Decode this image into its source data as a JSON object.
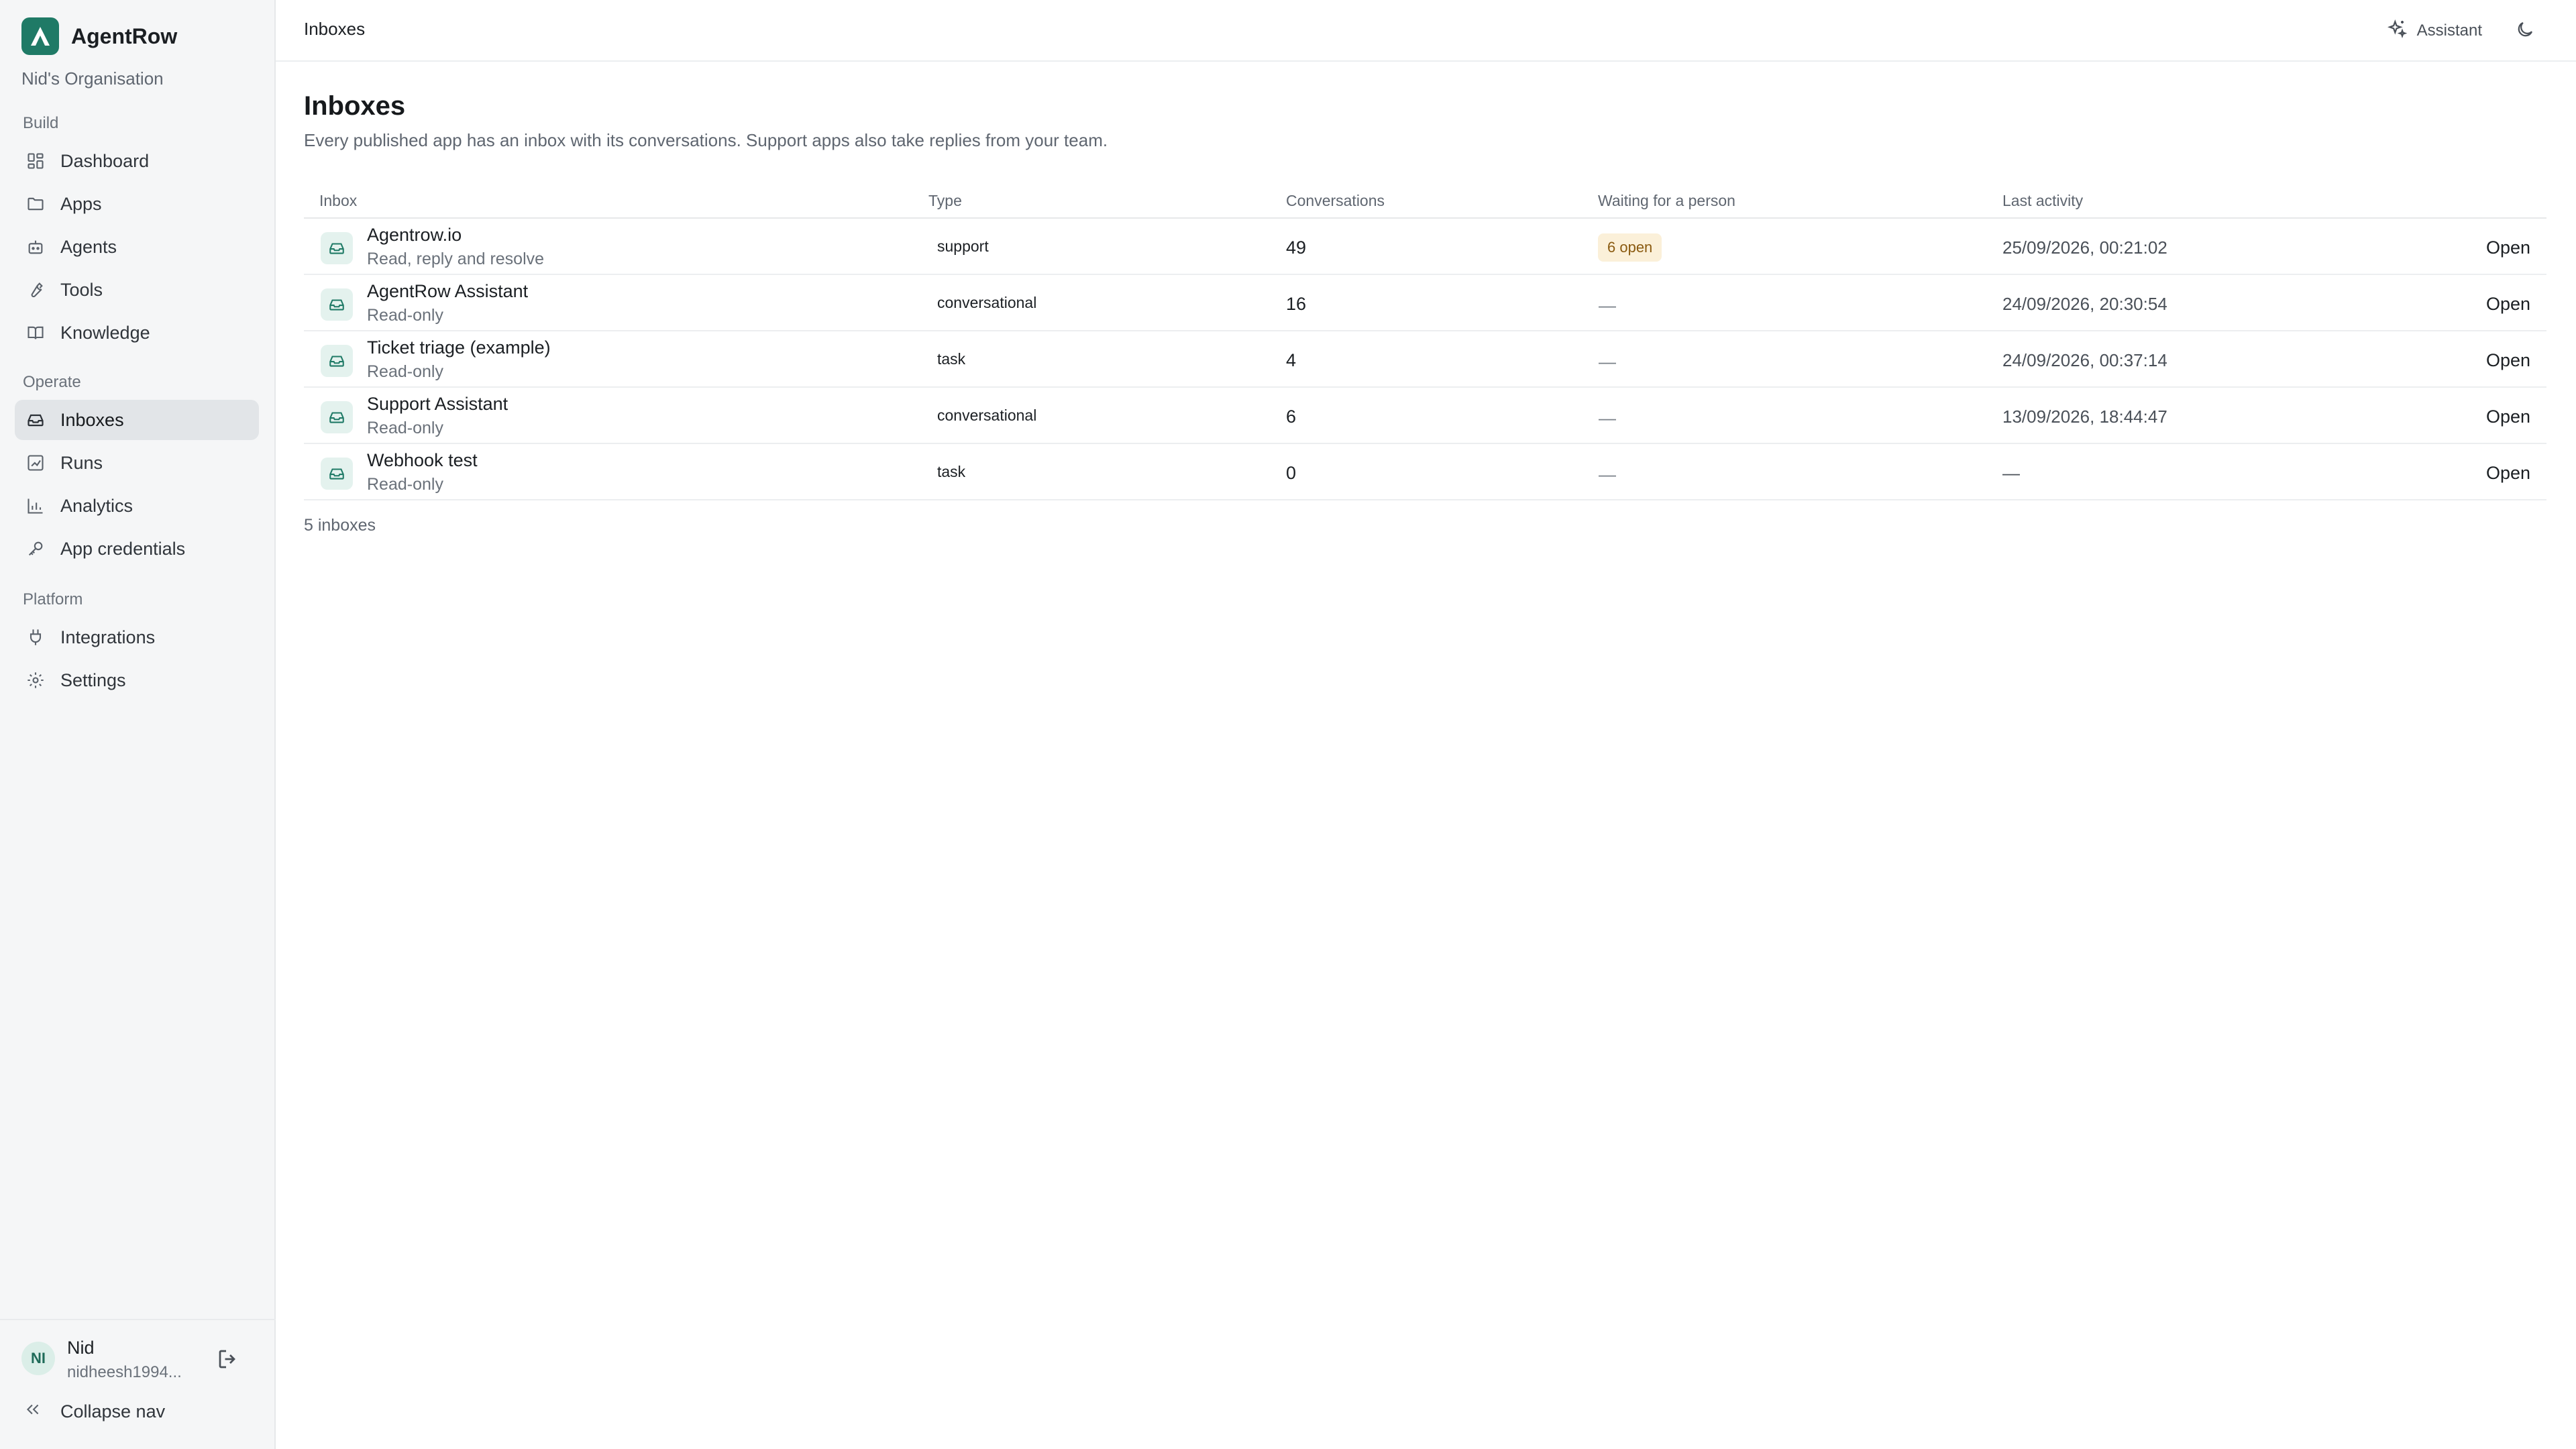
{
  "brand": {
    "name": "AgentRow",
    "logo_color": "#1f7a66"
  },
  "org": {
    "name": "Nid's Organisation"
  },
  "sidebar": {
    "sections": [
      {
        "label": "Build"
      },
      {
        "label": "Operate"
      },
      {
        "label": "Platform"
      }
    ],
    "items": [
      {
        "label": "Dashboard",
        "icon": "dashboard-icon"
      },
      {
        "label": "Apps",
        "icon": "folder-icon"
      },
      {
        "label": "Agents",
        "icon": "robot-icon"
      },
      {
        "label": "Tools",
        "icon": "wrench-icon"
      },
      {
        "label": "Knowledge",
        "icon": "book-icon"
      },
      {
        "label": "Inboxes",
        "icon": "inbox-icon",
        "active": true
      },
      {
        "label": "Runs",
        "icon": "runs-icon"
      },
      {
        "label": "Analytics",
        "icon": "bar-chart-icon"
      },
      {
        "label": "App credentials",
        "icon": "key-icon"
      },
      {
        "label": "Integrations",
        "icon": "plug-icon"
      },
      {
        "label": "Settings",
        "icon": "gear-icon"
      }
    ],
    "user": {
      "initials": "NI",
      "name": "Nid",
      "email": "nidheesh1994..."
    },
    "collapse_label": "Collapse nav"
  },
  "header": {
    "breadcrumb": "Inboxes",
    "assistant_label": "Assistant"
  },
  "main": {
    "title": "Inboxes",
    "subtitle": "Every published app has an inbox with its conversations. Support apps also take replies from your team.",
    "columns": [
      "Inbox",
      "Type",
      "Conversations",
      "Waiting for a person",
      "Last activity"
    ],
    "rows": [
      {
        "name": "Agentrow.io",
        "access": "Read, reply and resolve",
        "type": "support",
        "conversations": "49",
        "waiting": "6 open",
        "waiting_badge": true,
        "last_activity": "25/09/2026, 00:21:02",
        "action": "Open"
      },
      {
        "name": "AgentRow Assistant",
        "access": "Read-only",
        "type": "conversational",
        "conversations": "16",
        "waiting": "—",
        "waiting_badge": false,
        "last_activity": "24/09/2026, 20:30:54",
        "action": "Open"
      },
      {
        "name": "Ticket triage (example)",
        "access": "Read-only",
        "type": "task",
        "conversations": "4",
        "waiting": "—",
        "waiting_badge": false,
        "last_activity": "24/09/2026, 00:37:14",
        "action": "Open"
      },
      {
        "name": "Support Assistant",
        "access": "Read-only",
        "type": "conversational",
        "conversations": "6",
        "waiting": "—",
        "waiting_badge": false,
        "last_activity": "13/09/2026, 18:44:47",
        "action": "Open"
      },
      {
        "name": "Webhook test",
        "access": "Read-only",
        "type": "task",
        "conversations": "0",
        "waiting": "—",
        "waiting_badge": false,
        "last_activity": "—",
        "action": "Open"
      }
    ],
    "count_text": "5 inboxes"
  },
  "colors": {
    "accent": "#1f7a66",
    "badge_bg": "#fbf0d9",
    "badge_text": "#8a5a10"
  }
}
